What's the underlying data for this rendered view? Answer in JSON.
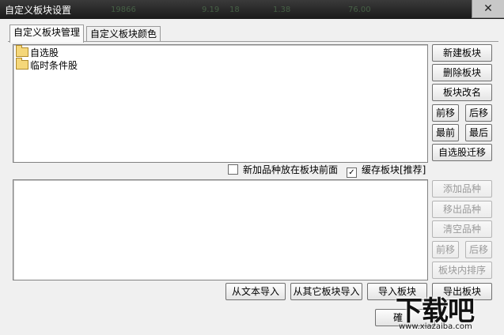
{
  "window": {
    "title": "自定义板块设置",
    "close_symbol": "✕",
    "background_ticker_noise": [
      "19866",
      "9.19",
      "18",
      "1.38",
      "76.00"
    ]
  },
  "tabs": [
    {
      "label": "自定义板块管理",
      "active": true
    },
    {
      "label": "自定义板块颜色",
      "active": false
    }
  ],
  "block_list": {
    "items": [
      {
        "label": "自选股",
        "icon": "folder-icon"
      },
      {
        "label": "临时条件股",
        "icon": "folder-icon"
      }
    ]
  },
  "block_buttons": {
    "new": "新建板块",
    "delete": "删除板块",
    "rename": "板块改名",
    "move_up": "前移",
    "move_down": "后移",
    "move_first": "最前",
    "move_last": "最后",
    "migrate": "自选股迁移"
  },
  "options": {
    "new_item_front": {
      "label": "新加品种放在板块前面",
      "checked": false
    },
    "cache_block": {
      "label": "缓存板块[推荐]",
      "checked": true,
      "check_mark": "✓"
    }
  },
  "stock_buttons": {
    "add": "添加品种",
    "remove": "移出品种",
    "clear": "清空品种",
    "move_up": "前移",
    "move_down": "后移",
    "sort": "板块内排序"
  },
  "import_buttons": {
    "from_text": "从文本导入",
    "from_other": "从其它板块导入",
    "import_block": "导入板块",
    "export_block": "导出板块"
  },
  "footer": {
    "confirm_partial": "確"
  },
  "watermark": {
    "main": "下载吧",
    "sub": "www.xiazaiba.com"
  }
}
